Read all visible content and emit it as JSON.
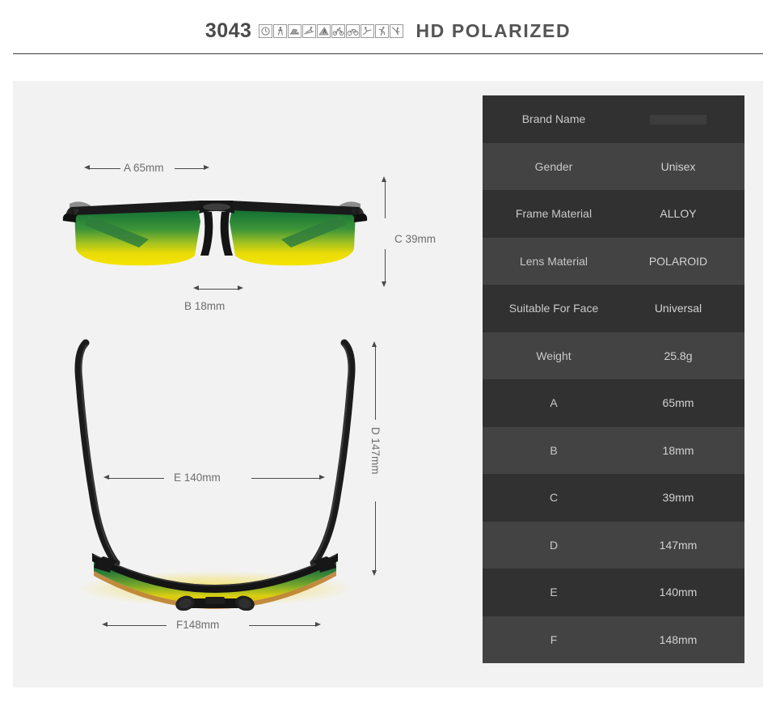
{
  "header": {
    "model_number": "3043",
    "tagline": "HD POLARIZED",
    "activity_icons": [
      "clock-icon",
      "walking-icon",
      "beach-chair-icon",
      "skiing-icon",
      "climbing-icon",
      "motorcycling-icon",
      "cycling-icon",
      "skating-icon",
      "running-icon",
      "fishing-icon"
    ]
  },
  "diagrams": {
    "front_view": {
      "alt": "sunglasses-front-view",
      "dimension_a": "A 65mm",
      "dimension_b": "B 18mm",
      "dimension_c": "C 39mm"
    },
    "top_view": {
      "alt": "sunglasses-top-view",
      "dimension_d": "D 147mm",
      "dimension_e": "E 140mm",
      "dimension_f": "F148mm"
    }
  },
  "spec_table": {
    "rows": [
      {
        "key": "Brand Name",
        "value": "",
        "redacted": true
      },
      {
        "key": "Gender",
        "value": "Unisex",
        "redacted": false
      },
      {
        "key": "Frame Material",
        "value": "ALLOY",
        "redacted": false
      },
      {
        "key": "Lens Material",
        "value": "POLAROID",
        "redacted": false
      },
      {
        "key": "Suitable For Face",
        "value": "Universal",
        "redacted": false
      },
      {
        "key": "Weight",
        "value": "25.8g",
        "redacted": false
      },
      {
        "key": "A",
        "value": "65mm",
        "redacted": false
      },
      {
        "key": "B",
        "value": "18mm",
        "redacted": false
      },
      {
        "key": "C",
        "value": "39mm",
        "redacted": false
      },
      {
        "key": "D",
        "value": "147mm",
        "redacted": false
      },
      {
        "key": "E",
        "value": "140mm",
        "redacted": false
      },
      {
        "key": "F",
        "value": "148mm",
        "redacted": false
      }
    ]
  },
  "colors": {
    "panel_background": "#f2f2f2",
    "row_dark": "#313131",
    "row_light": "#434343",
    "lens_green": "#1f7a38",
    "lens_yellow": "#f2e100",
    "frame_black": "#1b1b1b",
    "text_gray": "#6d6d6d"
  }
}
